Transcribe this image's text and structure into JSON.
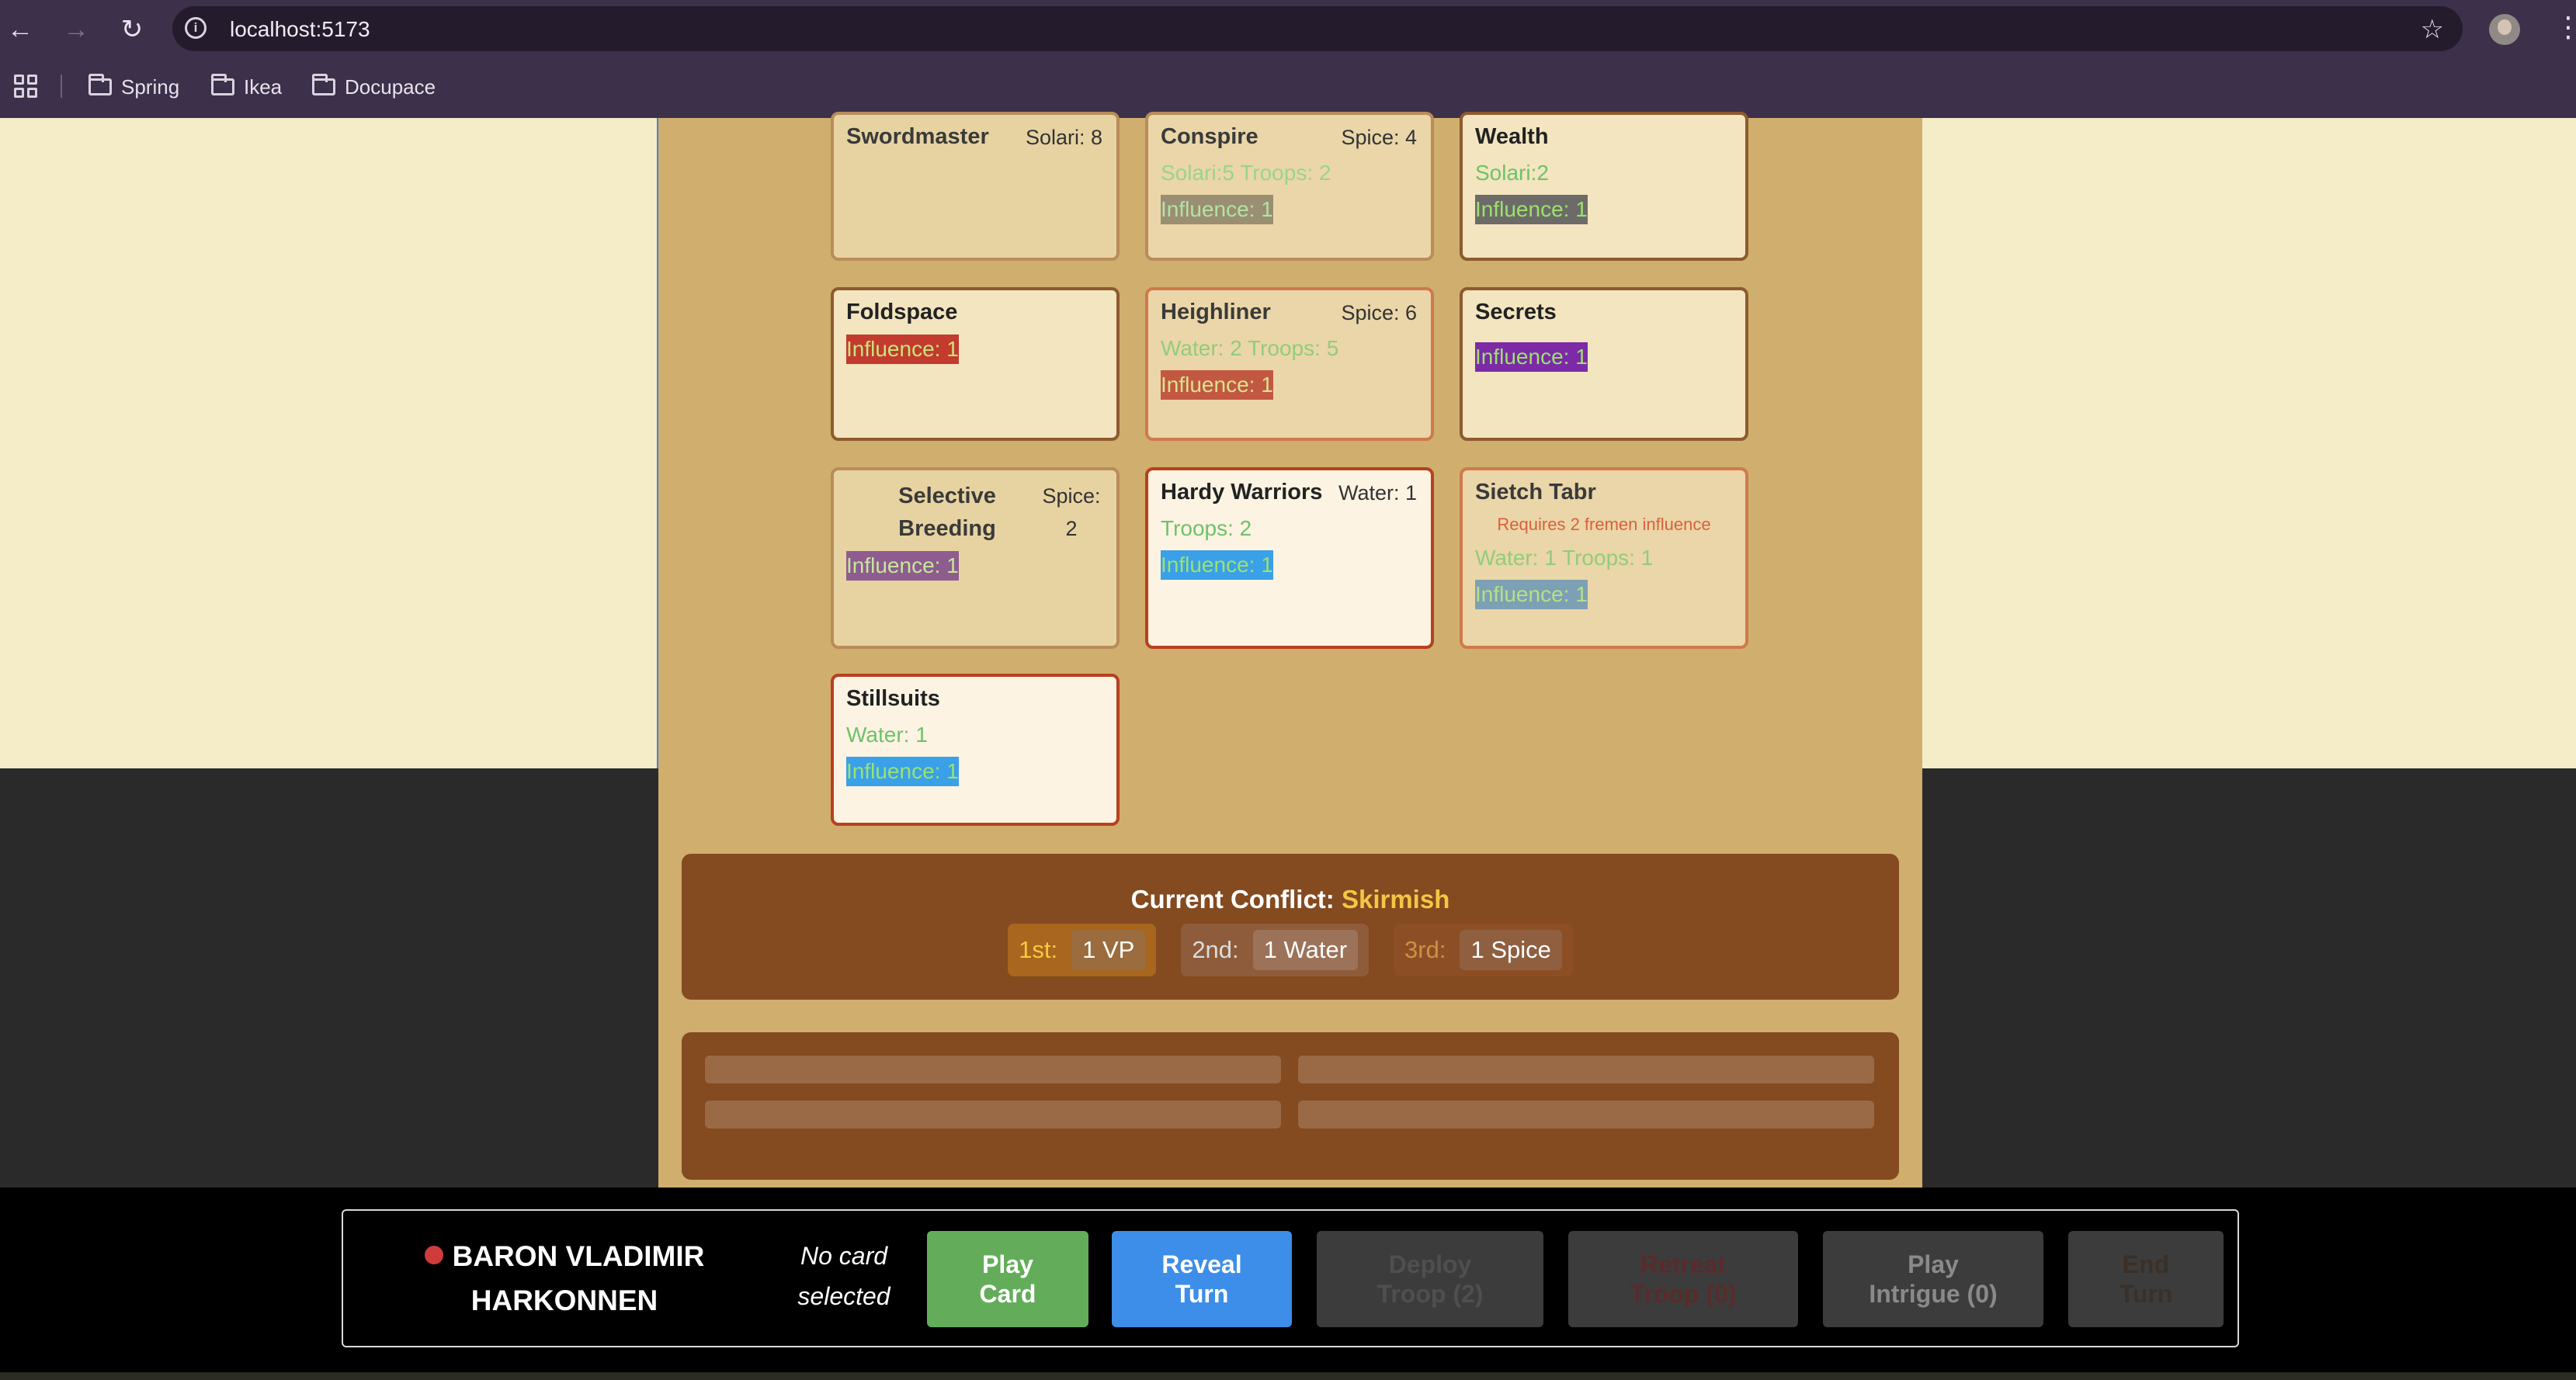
{
  "browser": {
    "url": "localhost:5173",
    "bookmarks": [
      {
        "label": "Spring"
      },
      {
        "label": "Ikea"
      },
      {
        "label": "Docupace"
      }
    ]
  },
  "cards": [
    {
      "name": "Swordmaster",
      "cost": "Solari: 8",
      "lines": [],
      "influence": ""
    },
    {
      "name": "Conspire",
      "cost": "Spice: 4",
      "lines": [
        "Solari:5  Troops: 2"
      ],
      "influence": "Influence: 1"
    },
    {
      "name": "Wealth",
      "cost": "",
      "lines": [
        "Solari:2"
      ],
      "influence": "Influence: 1"
    },
    {
      "name": "Foldspace",
      "cost": "",
      "lines": [],
      "influence": "Influence: 1"
    },
    {
      "name": "Heighliner",
      "cost": "Spice: 6",
      "lines": [
        "Water: 2  Troops: 5"
      ],
      "influence": "Influence: 1"
    },
    {
      "name": "Secrets",
      "cost": "",
      "lines": [],
      "influence": "Influence: 1"
    },
    {
      "name": "Selective Breeding",
      "cost": "Spice: 2",
      "lines": [],
      "influence": "Influence: 1"
    },
    {
      "name": "Hardy Warriors",
      "cost": "Water: 1",
      "lines": [
        "Troops: 2"
      ],
      "influence": "Influence: 1"
    },
    {
      "name": "Sietch Tabr",
      "cost": "",
      "requirement": "Requires 2 fremen influence",
      "lines": [
        "Water: 1  Troops: 1"
      ],
      "influence": "Influence: 1"
    },
    {
      "name": "Stillsuits",
      "cost": "",
      "lines": [
        "Water: 1"
      ],
      "influence": "Influence: 1"
    }
  ],
  "conflict": {
    "label": "Current Conflict:",
    "name": "Skirmish",
    "rewards": [
      {
        "place": "1st:",
        "value": "1 VP"
      },
      {
        "place": "2nd:",
        "value": "1 Water"
      },
      {
        "place": "3rd:",
        "value": "1 Spice"
      }
    ]
  },
  "player": {
    "name_line1": "BARON VLADIMIR",
    "name_line2": "HARKONNEN",
    "color": "#d03b3b",
    "selection_line1": "No card",
    "selection_line2": "selected"
  },
  "actions": {
    "play_card": [
      "Play",
      "Card"
    ],
    "reveal_turn": [
      "Reveal",
      "Turn"
    ],
    "deploy_troop": [
      "Deploy",
      "Troop (2)"
    ],
    "retreat_troop": [
      "Retreat",
      "Troop (0)"
    ],
    "play_intrigue": [
      "Play",
      "Intrigue (0)"
    ],
    "end_turn": [
      "End",
      "Turn"
    ]
  },
  "colors": {
    "board": "#cfae6e",
    "side_panels": "#f5ecc8",
    "conflict_panel": "#844a20",
    "play_button": "#63ad5a",
    "reveal_button": "#3d8ee8"
  }
}
